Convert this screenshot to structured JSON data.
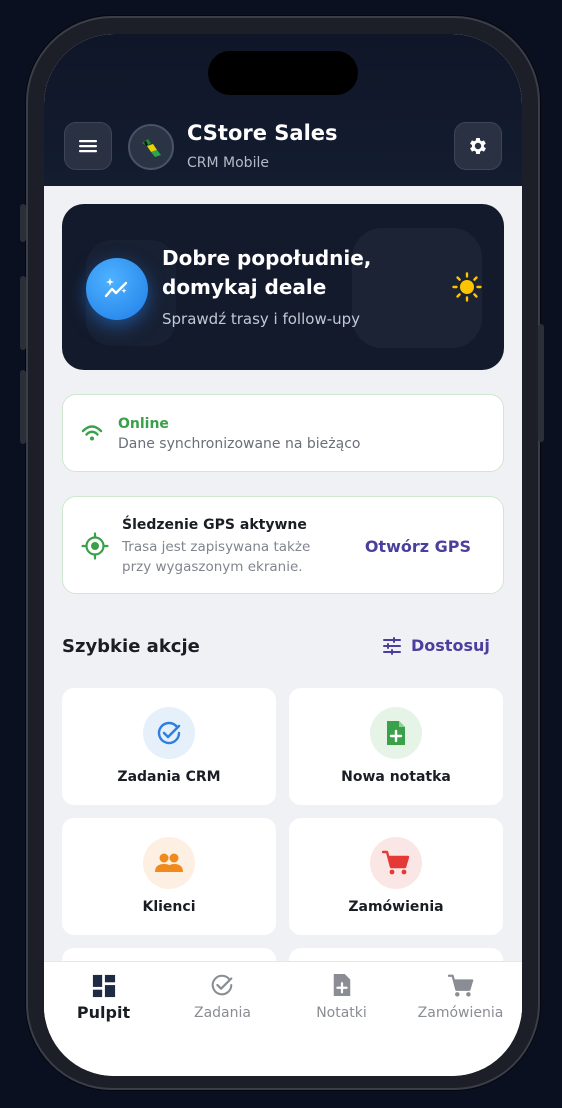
{
  "header": {
    "app_title": "CStore Sales",
    "app_subtitle": "CRM Mobile",
    "menu_icon": "hamburger-menu-icon",
    "settings_icon": "gear-icon"
  },
  "hero": {
    "title_line1": "Dobre popołudnie,",
    "title_line2": "domykaj deale",
    "subtitle": "Sprawdź trasy i follow-upy",
    "icon": "sparkle-trend-icon",
    "weather_icon": "sun-icon"
  },
  "status": {
    "title": "Online",
    "subtitle": "Dane synchronizowane na bieżąco",
    "icon": "wifi-icon"
  },
  "gps": {
    "title": "Śledzenie GPS aktywne",
    "subtitle": "Trasa jest zapisywana także przy wygaszonym ekranie.",
    "link": "Otwórz GPS",
    "icon": "gps-target-icon"
  },
  "quick_actions": {
    "title": "Szybkie akcje",
    "customize_label": "Dostosuj",
    "tiles": [
      {
        "label": "Zadania CRM",
        "icon": "check-circle-icon",
        "color": "#2f7fe0",
        "bg": "#e6f0fb"
      },
      {
        "label": "Nowa notatka",
        "icon": "note-add-icon",
        "color": "#3aa14a",
        "bg": "#e6f4e8"
      },
      {
        "label": "Klienci",
        "icon": "people-icon",
        "color": "#f08a1c",
        "bg": "#fdf0e2"
      },
      {
        "label": "Zamówienia",
        "icon": "cart-icon",
        "color": "#e53935",
        "bg": "#fbe6e6"
      }
    ]
  },
  "tabbar": {
    "tabs": [
      {
        "label": "Pulpit",
        "icon": "dashboard-icon",
        "active": true
      },
      {
        "label": "Zadania",
        "icon": "check-circle-icon",
        "active": false
      },
      {
        "label": "Notatki",
        "icon": "note-add-icon",
        "active": false
      },
      {
        "label": "Zamówienia",
        "icon": "cart-icon",
        "active": false
      }
    ]
  },
  "colors": {
    "header_bg": "#0f1628",
    "accent": "#4b3f9e",
    "online_green": "#3aa14a"
  }
}
